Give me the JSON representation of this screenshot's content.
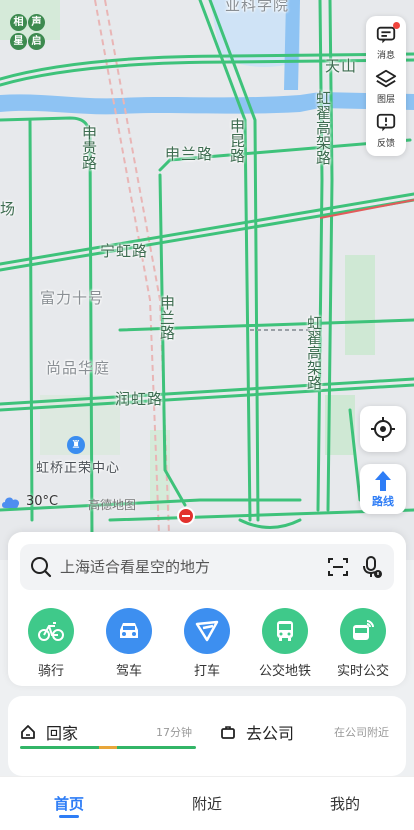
{
  "colors": {
    "road_green": "#34c072",
    "water_blue": "#7bb8f0",
    "park_green": "#c8e6cf",
    "accent_blue": "#2e7df6",
    "alert_red": "#e2322d"
  },
  "map": {
    "labels": {
      "top_poi": "业科学院",
      "tianshan": "天山",
      "honghe_road_top": "虹翟高架路",
      "shenzhi_road": "申贵路",
      "shenlan_road": "申兰路",
      "shenkun_road": "申昆路",
      "chang": "场",
      "ninghong_road": "宁虹路",
      "fuli_shihao": "富力十号",
      "shanglan_road": "申兰路",
      "honghe_road_mid": "虹翟高架路",
      "shangpin_huating": "尚品华庭",
      "runhong_road": "润虹路",
      "hongqiao_zhengrong": "虹桥正荣中心"
    },
    "logo_chars": [
      "相",
      "声",
      "星",
      "启"
    ],
    "weather": {
      "temperature": "30°C",
      "icon": "cloud-icon"
    },
    "brand": "高德地图"
  },
  "toolbar": {
    "messages_label": "消息",
    "layers_label": "图层",
    "feedback_label": "反馈",
    "route_label": "路线"
  },
  "search": {
    "placeholder": "上海适合看星空的地方"
  },
  "quick_actions": [
    {
      "label": "骑行",
      "icon": "bicycle-icon",
      "color": "#3fc98a"
    },
    {
      "label": "驾车",
      "icon": "car-icon",
      "color": "#3d8ff0"
    },
    {
      "label": "打车",
      "icon": "taxi-icon",
      "color": "#3d8ff0"
    },
    {
      "label": "公交地铁",
      "icon": "bus-icon",
      "color": "#3fc98a"
    },
    {
      "label": "实时公交",
      "icon": "realtime-bus-icon",
      "color": "#3fc98a"
    }
  ],
  "favorites": {
    "home": {
      "label": "回家",
      "eta": "17分钟"
    },
    "company": {
      "label": "去公司",
      "hint": "在公司附近"
    }
  },
  "tabs": [
    {
      "label": "首页",
      "active": true
    },
    {
      "label": "附近",
      "active": false
    },
    {
      "label": "我的",
      "active": false
    }
  ]
}
